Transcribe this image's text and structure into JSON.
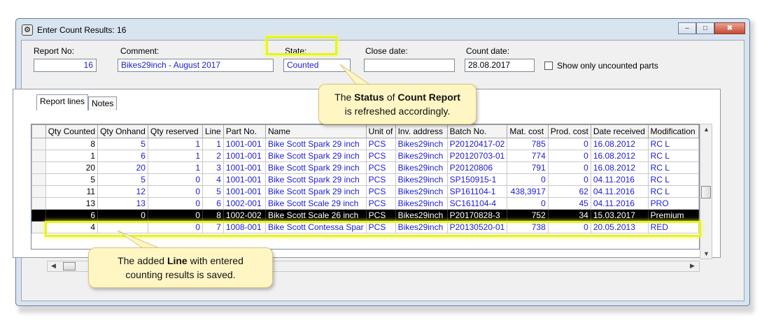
{
  "window": {
    "title": "Enter Count Results: 16",
    "minimize": "–",
    "maximize": "□",
    "close": "✖"
  },
  "header": {
    "report_no_label": "Report No:",
    "report_no": "16",
    "comment_label": "Comment:",
    "comment": "Bikes29inch - August 2017",
    "state_label": "State:",
    "state": "Counted",
    "close_date_label": "Close date:",
    "close_date": "",
    "count_date_label": "Count date:",
    "count_date": "28.08.2017",
    "uncounted_label": "Show only uncounted parts"
  },
  "tabs": [
    {
      "label": "Report lines"
    },
    {
      "label": "Notes"
    }
  ],
  "grid": {
    "columns": [
      "Qty Counted",
      "Qty Onhand",
      "Qty reserved",
      "Line",
      "Part No.",
      "Name",
      "Unit of",
      "Inv. address",
      "Batch No.",
      "Mat. cost",
      "Prod. cost",
      "Date received",
      "Modification"
    ],
    "rows": [
      [
        "8",
        "5",
        "1",
        "1",
        "1001-001",
        "Bike Scott Spark 29 inch",
        "PCS",
        "Bikes29inch",
        "P20120417-02",
        "785",
        "0",
        "16.08.2012",
        "RC L"
      ],
      [
        "1",
        "6",
        "1",
        "2",
        "1001-001",
        "Bike Scott Spark 29 inch",
        "PCS",
        "Bikes29inch",
        "P20120703-01",
        "774",
        "0",
        "16.08.2012",
        "RC L"
      ],
      [
        "20",
        "20",
        "1",
        "3",
        "1001-001",
        "Bike Scott Spark 29 inch",
        "PCS",
        "Bikes29inch",
        "P20120806",
        "791",
        "0",
        "16.08.2012",
        "RC L"
      ],
      [
        "5",
        "5",
        "0",
        "4",
        "1001-001",
        "Bike Scott Spark 29 inch",
        "PCS",
        "Bikes29inch",
        "SP150915-1",
        "0",
        "0",
        "04.11.2016",
        "RC L"
      ],
      [
        "11",
        "12",
        "0",
        "5",
        "1001-001",
        "Bike Scott Spark 29 inch",
        "PCS",
        "Bikes29inch",
        "SP161104-1",
        "438,3917",
        "62",
        "04.11.2016",
        "RC L"
      ],
      [
        "13",
        "13",
        "0",
        "6",
        "1002-001",
        "Bike Scott Scale 29 inch",
        "PCS",
        "Bikes29inch",
        "SC161104-4",
        "0",
        "45",
        "04.11.2016",
        "PRO"
      ],
      [
        "6",
        "0",
        "0",
        "8",
        "1002-002",
        "Bike Scott Scale 26 inch",
        "PCS",
        "Bikes29inch",
        "P20170828-3",
        "752",
        "34",
        "15.03.2017",
        "Premium"
      ],
      [
        "4",
        "",
        "0",
        "7",
        "1008-001",
        "Bike Scott Contessa Spar",
        "PCS",
        "Bikes29inch",
        "P20130520-01",
        "738",
        "0",
        "20.05.2013",
        "RED"
      ]
    ],
    "selected_row": 6
  },
  "callouts": {
    "status": {
      "pre": "The ",
      "bold": "Status",
      "mid": " of ",
      "bold2": "Count Report",
      "line2": "is refreshed accordingly."
    },
    "line": {
      "pre": "The added ",
      "bold": "Line",
      "post": " with entered",
      "line2": "counting results is saved."
    }
  },
  "colors": {
    "highlight": "#e6f51a",
    "callout_bg": "#fff6c4",
    "field_text_blue": "#1b1bd6"
  }
}
